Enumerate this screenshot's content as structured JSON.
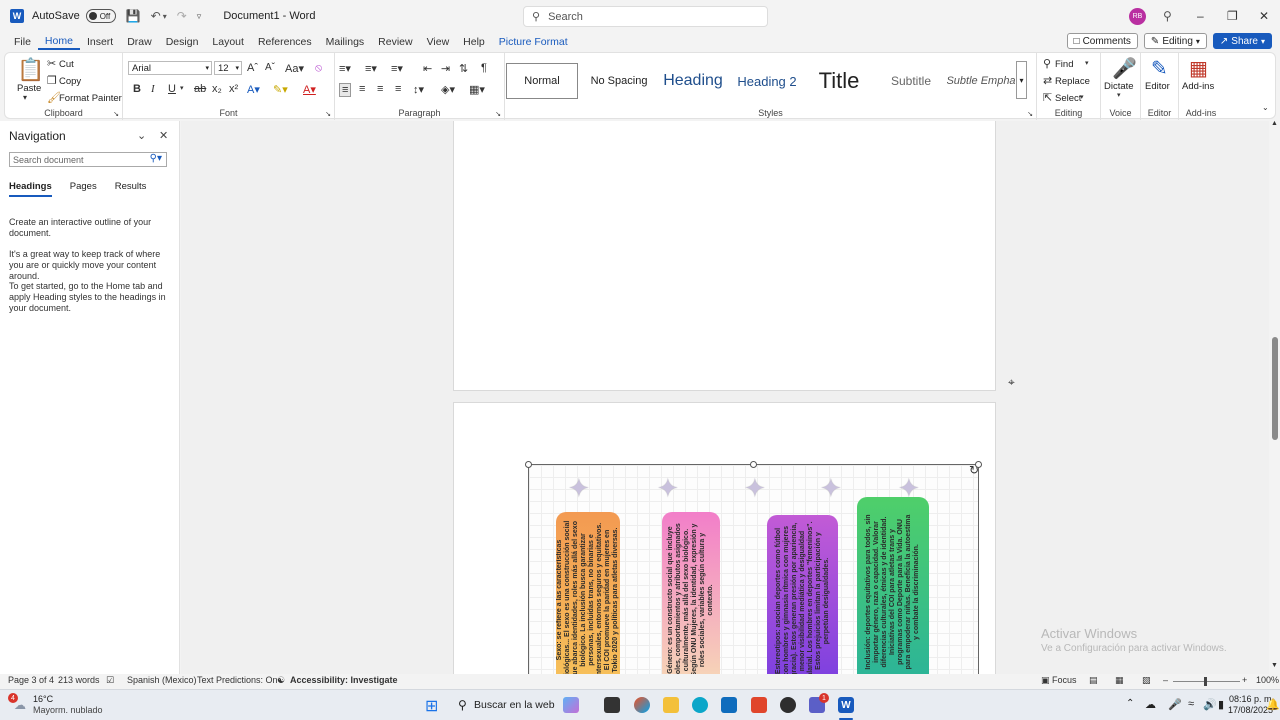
{
  "titlebar": {
    "autosave_label": "AutoSave",
    "autosave_state": "Off",
    "doc_title": "Document1  -  Word",
    "search_placeholder": "Search",
    "avatar_initials": "RB"
  },
  "menu": {
    "tabs": [
      "File",
      "Home",
      "Insert",
      "Draw",
      "Design",
      "Layout",
      "References",
      "Mailings",
      "Review",
      "View",
      "Help",
      "Picture Format"
    ],
    "comments": "Comments",
    "editing": "Editing",
    "share": "Share"
  },
  "ribbon": {
    "clipboard": {
      "paste": "Paste",
      "cut": "Cut",
      "copy": "Copy",
      "format_painter": "Format Painter",
      "label": "Clipboard"
    },
    "font": {
      "name": "Arial",
      "size": "12",
      "label": "Font"
    },
    "paragraph": {
      "label": "Paragraph"
    },
    "styles": {
      "items": [
        "Normal",
        "No Spacing",
        "Heading",
        "Heading 2",
        "Title",
        "Subtitle",
        "Subtle Empha"
      ],
      "label": "Styles"
    },
    "editing": {
      "find": "Find",
      "replace": "Replace",
      "select": "Select",
      "label": "Editing"
    },
    "voice": {
      "dictate": "Dictate",
      "label": "Voice"
    },
    "editor": {
      "editor": "Editor",
      "label": "Editor"
    },
    "addins": {
      "addins": "Add-ins",
      "label": "Add-ins"
    }
  },
  "navigation": {
    "title": "Navigation",
    "search_placeholder": "Search document",
    "tabs": [
      "Headings",
      "Pages",
      "Results"
    ],
    "para1": "Create an interactive outline of your document.",
    "para2": "It's a great way to keep track of where you are or quickly move your content around.",
    "para3": "To get started, go to the Home tab and apply Heading styles to the headings in your document."
  },
  "document": {
    "cards": [
      {
        "color_top": "#f39a52",
        "color_bottom": "#f7c25a",
        "text": "Sexo: se refiere a las características biológicas... El sexo es una construcción social que abarca identidades, roles más allá del sexo biológico. La inclusión busca garantizar personas, incluidas trans, no binarias e intersexuales, entornos seguros y equitativos. El COI promueve la paridad en mujeres en Tokio 2020 y políticas para atletas diversas."
      },
      {
        "color_top": "#f27ec9",
        "color_bottom": "#f7d9b6",
        "text": "Género: es un constructo social que incluye roles, comportamientos y atributos asignados culturalmente, más allá del sexo biológico. Según ONU Mujeres, la identidad, expresión y roles sociales, variables según cultura y contexto."
      },
      {
        "color_top": "#c25bd6",
        "color_bottom": "#7a3fe0",
        "text": "Estereotipos: asocian deportes como fútbol con hombres y gimnasia rítmica con mujeres (gracia). Estos generan presión por apariencia, menor visibilidad mediática y desigualdad salarial. Los hombres en deportes \"femeninos\". Estos prejuicios limitan la participación y perpetúan desigualdades."
      },
      {
        "color_top": "#4fcf6a",
        "color_bottom": "#2ab39a",
        "text": "Inclusión: deportes equitativos para todos, sin importar género, raza o capacidad. Valorar diferencias culturales, étnicas y de identidad. Iniciativas del COI para atletas trans y programas como Deporte para la Vida. ONU para empoderar niñas. Beneficia la autoestima y combate la discriminación."
      }
    ]
  },
  "watermark": {
    "line1": "Activar Windows",
    "line2": "Ve a Configuración para activar Windows."
  },
  "status": {
    "page": "Page 3 of 4",
    "words": "213 words",
    "language": "Spanish (Mexico)",
    "predictions": "Text Predictions: On",
    "accessibility": "Accessibility: Investigate",
    "focus": "Focus",
    "zoom": "100%"
  },
  "taskbar": {
    "weather_temp": "16°C",
    "weather_desc": "Mayorm. nublado",
    "search": "Buscar en la web",
    "badge": "4",
    "badge2": "1",
    "time": "08:16 p. m.",
    "date": "17/08/2025"
  }
}
